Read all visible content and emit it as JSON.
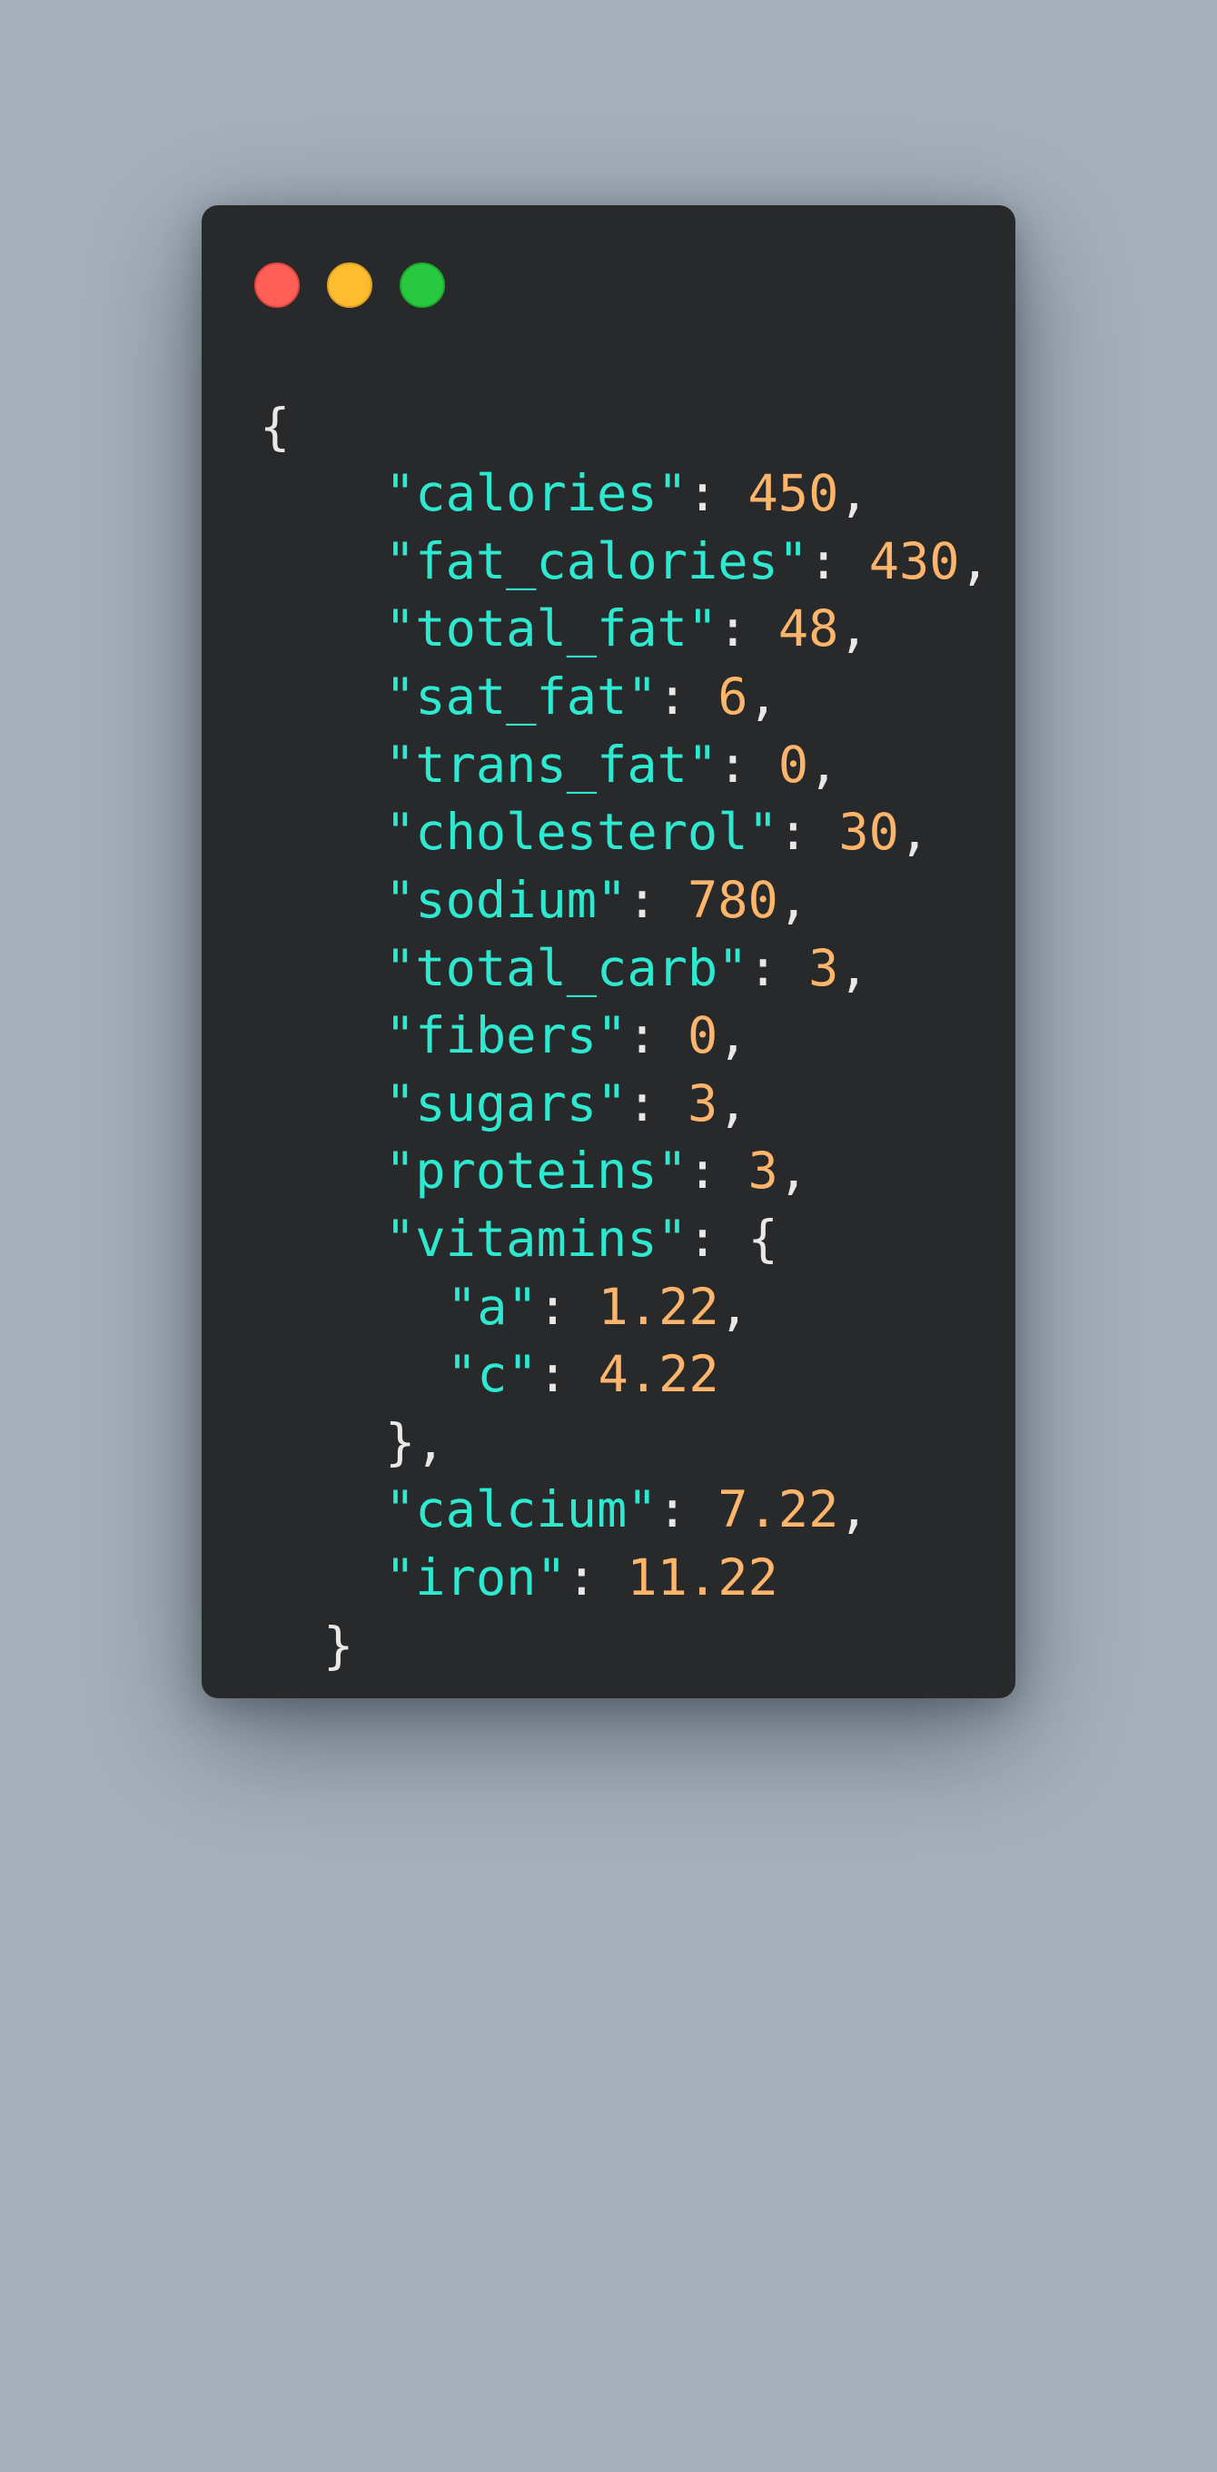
{
  "window": {
    "buttons": [
      "close",
      "minimize",
      "maximize"
    ],
    "colors": {
      "background": "#28292b",
      "key": "#2ee8d0",
      "number": "#fcb56a",
      "punctuation": "#e8e8e8"
    }
  },
  "code": {
    "open_brace": "{",
    "close_brace": "}",
    "entries": [
      {
        "key": "\"calories\"",
        "value": "450"
      },
      {
        "key": "\"fat_calories\"",
        "value": "430"
      },
      {
        "key": "\"total_fat\"",
        "value": "48"
      },
      {
        "key": "\"sat_fat\"",
        "value": "6"
      },
      {
        "key": "\"trans_fat\"",
        "value": "0"
      },
      {
        "key": "\"cholesterol\"",
        "value": "30"
      },
      {
        "key": "\"sodium\"",
        "value": "780"
      },
      {
        "key": "\"total_carb\"",
        "value": "3"
      },
      {
        "key": "\"fibers\"",
        "value": "0"
      },
      {
        "key": "\"sugars\"",
        "value": "3"
      },
      {
        "key": "\"proteins\"",
        "value": "3"
      }
    ],
    "vitamins": {
      "key": "\"vitamins\"",
      "open": "{",
      "close": "},",
      "entries": [
        {
          "key": "\"a\"",
          "value": "1.22"
        },
        {
          "key": "\"c\"",
          "value": "4.22"
        }
      ]
    },
    "tail_entries": [
      {
        "key": "\"calcium\"",
        "value": "7.22"
      },
      {
        "key": "\"iron\"",
        "value": "11.22"
      }
    ]
  }
}
